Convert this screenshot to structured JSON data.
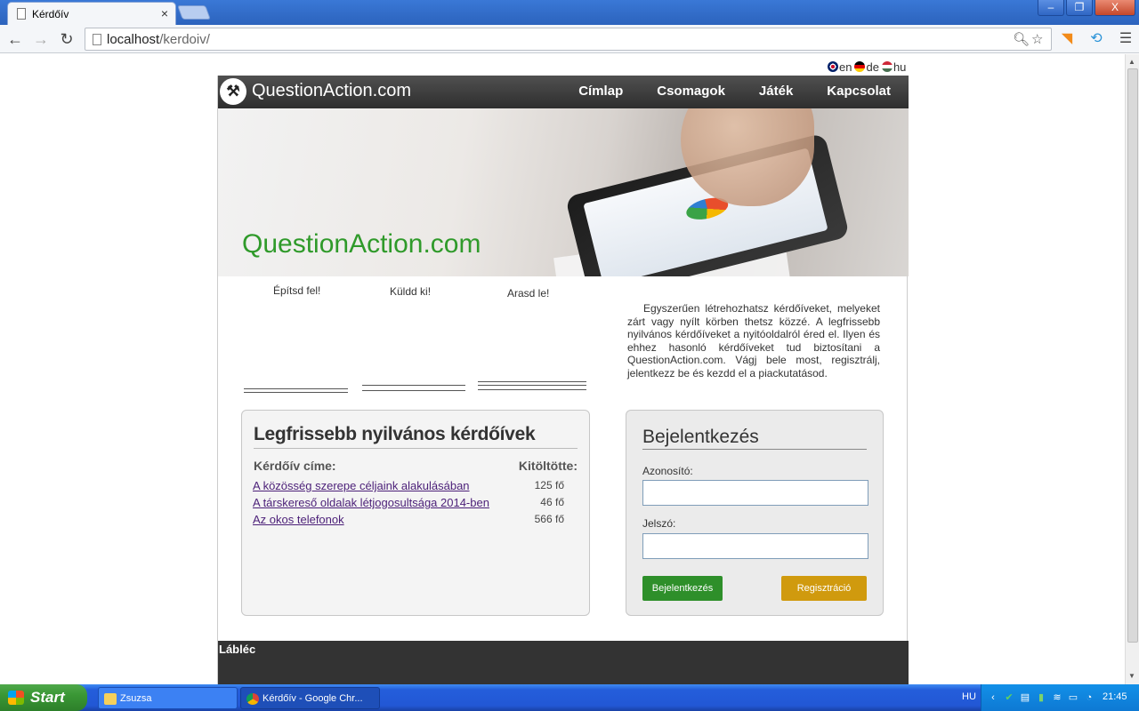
{
  "browser": {
    "tab_title": "Kérdőív",
    "tab_close": "×",
    "url_host": "localhost",
    "url_path": "/kerdoiv/",
    "win_min": "‒",
    "win_max": "❐",
    "win_close": "X"
  },
  "languages": [
    {
      "code": "en"
    },
    {
      "code": "de"
    },
    {
      "code": "hu"
    }
  ],
  "site": {
    "logo_text": "QuestionAction.com",
    "menu": [
      "Címlap",
      "Csomagok",
      "Játék",
      "Kapcsolat"
    ],
    "hero_title": "QuestionAction.com",
    "steps": [
      "Építsd fel!",
      "Küldd ki!",
      "Arasd le!"
    ],
    "intro": "Egyszerűen létrehozhatsz kérdőíveket, melyeket zárt vagy nyílt körben thetsz közzé. A legfrissebb nyilvános kérdőíveket a nyitóoldalról éred el. Ilyen és ehhez hasonló kérdőíveket tud biztosítani a QuestionAction.com. Vágj bele most, regisztrálj, jelentkezz be és kezdd el a piackutatásod.",
    "recent": {
      "title": "Legfrissebb nyilvános kérdőívek",
      "col_title": "Kérdőív címe:",
      "col_filled": "Kitöltötte:",
      "rows": [
        {
          "title": "A közösség szerepe céljaink alakulásában",
          "count": "125 fő"
        },
        {
          "title": "A társkereső oldalak létjogosultsága 2014-ben",
          "count": "46 fő"
        },
        {
          "title": "Az okos telefonok",
          "count": "566 fő"
        }
      ]
    },
    "login": {
      "title": "Bejelentkezés",
      "username_label": "Azonosító:",
      "password_label": "Jelszó:",
      "username_value": "",
      "password_value": "",
      "login_button": "Bejelentkezés",
      "register_button": "Regisztráció"
    },
    "footer": "Lábléc"
  },
  "taskbar": {
    "start": "Start",
    "items": [
      "Zsuzsa",
      "Kérdőív - Google Chr..."
    ],
    "language": "HU",
    "clock": "21:45"
  }
}
